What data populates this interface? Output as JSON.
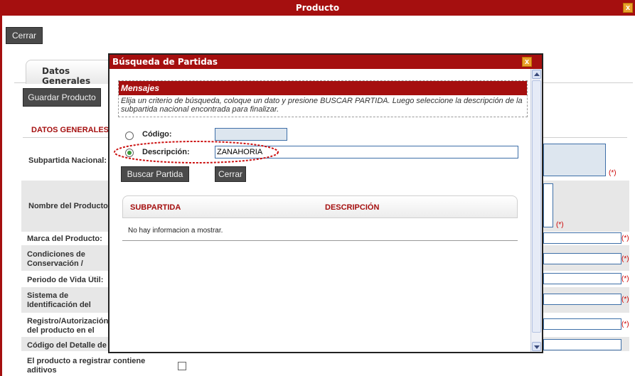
{
  "outer": {
    "title": "Producto",
    "close_label": "x",
    "cerrar_label": "Cerrar",
    "tab_label": "Datos Generales",
    "guardar_label": "Guardar Producto",
    "section_title": "DATOS GENERALES",
    "required_mark": "(*)",
    "fields": [
      {
        "label": "Subpartida Nacional:"
      },
      {
        "label": "Nombre del Producto:"
      },
      {
        "label": "Marca del Producto:"
      },
      {
        "label": "Condiciones de Conservación / Almacenamiento:"
      },
      {
        "label": "Periodo de Vida Útil:"
      },
      {
        "label": "Sistema de Identificación del Producto:"
      },
      {
        "label": "Registro/Autorización del producto en el país de"
      },
      {
        "label": "Código del Detalle de"
      },
      {
        "label": "El producto a registrar contiene aditivos"
      }
    ]
  },
  "modal": {
    "title": "Búsqueda de Partidas",
    "close_label": "x",
    "mensajes_header": "Mensajes",
    "mensajes_text": "Elija un criterio de búsqueda, coloque un dato y presione BUSCAR PARTIDA. Luego seleccione la descripción de la subpartida nacional encontrada para finalizar.",
    "codigo_label": "Código:",
    "codigo_value": "",
    "descripcion_label": "Descripción:",
    "descripcion_value": "ZANAHORIA",
    "selected_criterion": "descripcion",
    "buscar_label": "Buscar Partida",
    "cerrar_label": "Cerrar",
    "results": {
      "columns": [
        "SUBPARTIDA",
        "DESCRIPCIÓN"
      ],
      "empty_text": "No hay informacion a mostrar."
    }
  },
  "colors": {
    "accent": "#a50f0f",
    "input_border": "#3e6fa8",
    "button_dark": "#4a4a4a",
    "close_icon": "#e9a12b",
    "highlight_ellipse": "#cc1111"
  }
}
